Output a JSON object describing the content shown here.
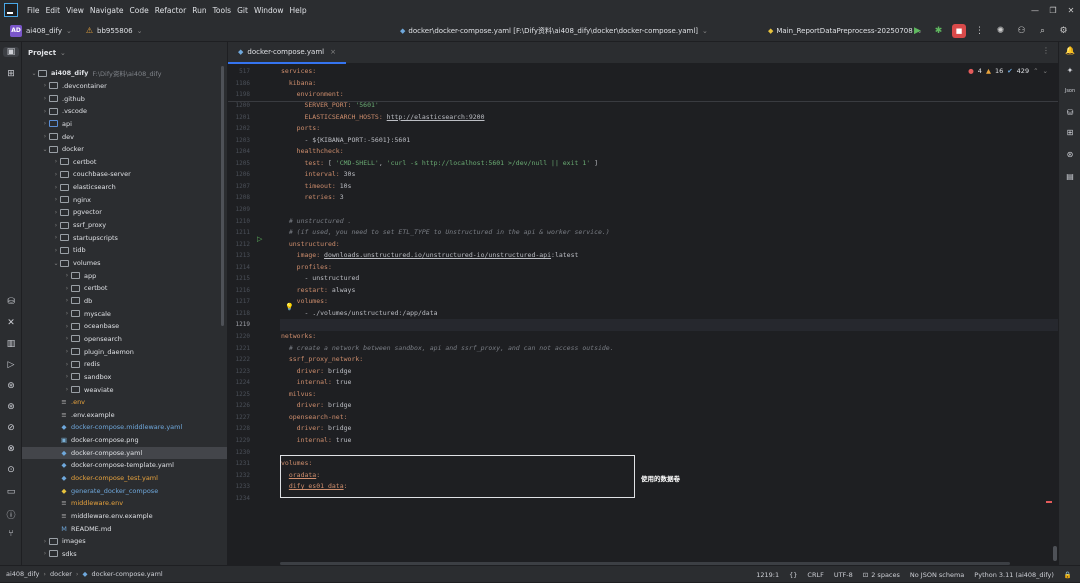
{
  "menu": [
    "File",
    "Edit",
    "View",
    "Navigate",
    "Code",
    "Refactor",
    "Run",
    "Tools",
    "Git",
    "Window",
    "Help"
  ],
  "window_controls": [
    "—",
    "❐",
    "✕"
  ],
  "toolbar": {
    "project_badge": "AD",
    "project_name": "ai408_dify",
    "branch": "bb955806",
    "file_path": "docker\\docker-compose.yaml [F:\\Dify资料\\ai408_dify\\docker\\docker-compose.yaml]",
    "run_config": "Main_ReportDataPreprocess-20250708"
  },
  "project_panel": {
    "title": "Project",
    "tree": [
      {
        "label": "ai408_dify",
        "extra": "F:\\Dify资料\\ai408_dify",
        "indent": 0,
        "type": "root",
        "open": true
      },
      {
        "label": ".devcontainer",
        "indent": 1,
        "type": "folder"
      },
      {
        "label": ".github",
        "indent": 1,
        "type": "folder"
      },
      {
        "label": ".vscode",
        "indent": 1,
        "type": "folder"
      },
      {
        "label": "api",
        "indent": 1,
        "type": "folder-blue"
      },
      {
        "label": "dev",
        "indent": 1,
        "type": "folder"
      },
      {
        "label": "docker",
        "indent": 1,
        "type": "folder",
        "open": true
      },
      {
        "label": "certbot",
        "indent": 2,
        "type": "folder"
      },
      {
        "label": "couchbase-server",
        "indent": 2,
        "type": "folder"
      },
      {
        "label": "elasticsearch",
        "indent": 2,
        "type": "folder"
      },
      {
        "label": "nginx",
        "indent": 2,
        "type": "folder"
      },
      {
        "label": "pgvector",
        "indent": 2,
        "type": "folder"
      },
      {
        "label": "ssrf_proxy",
        "indent": 2,
        "type": "folder"
      },
      {
        "label": "startupscripts",
        "indent": 2,
        "type": "folder"
      },
      {
        "label": "tidb",
        "indent": 2,
        "type": "folder"
      },
      {
        "label": "volumes",
        "indent": 2,
        "type": "folder",
        "open": true
      },
      {
        "label": "app",
        "indent": 3,
        "type": "folder"
      },
      {
        "label": "certbot",
        "indent": 3,
        "type": "folder"
      },
      {
        "label": "db",
        "indent": 3,
        "type": "folder"
      },
      {
        "label": "myscale",
        "indent": 3,
        "type": "folder"
      },
      {
        "label": "oceanbase",
        "indent": 3,
        "type": "folder"
      },
      {
        "label": "opensearch",
        "indent": 3,
        "type": "folder"
      },
      {
        "label": "plugin_daemon",
        "indent": 3,
        "type": "folder"
      },
      {
        "label": "redis",
        "indent": 3,
        "type": "folder"
      },
      {
        "label": "sandbox",
        "indent": 3,
        "type": "folder"
      },
      {
        "label": "weaviate",
        "indent": 3,
        "type": "folder"
      },
      {
        "label": ".env",
        "indent": 2,
        "type": "file-env",
        "color": "#e8a33d"
      },
      {
        "label": ".env.example",
        "indent": 2,
        "type": "file-env",
        "color": "#dfe1e5"
      },
      {
        "label": "docker-compose.middleware.yaml",
        "indent": 2,
        "type": "file-docker",
        "color": "#6fa8dc"
      },
      {
        "label": "docker-compose.png",
        "indent": 2,
        "type": "file-img",
        "color": "#dfe1e5"
      },
      {
        "label": "docker-compose.yaml",
        "indent": 2,
        "type": "file-docker",
        "color": "#dfe1e5",
        "selected": true
      },
      {
        "label": "docker-compose-template.yaml",
        "indent": 2,
        "type": "file-docker",
        "color": "#dfe1e5"
      },
      {
        "label": "docker-compose_test.yaml",
        "indent": 2,
        "type": "file-docker",
        "color": "#e8a33d"
      },
      {
        "label": "generate_docker_compose",
        "indent": 2,
        "type": "file-py",
        "color": "#6fa8dc"
      },
      {
        "label": "middleware.env",
        "indent": 2,
        "type": "file-env",
        "color": "#e8a33d"
      },
      {
        "label": "middleware.env.example",
        "indent": 2,
        "type": "file-env",
        "color": "#dfe1e5"
      },
      {
        "label": "README.md",
        "indent": 2,
        "type": "file-md",
        "color": "#dfe1e5"
      },
      {
        "label": "images",
        "indent": 1,
        "type": "folder"
      },
      {
        "label": "sdks",
        "indent": 1,
        "type": "folder"
      }
    ]
  },
  "editor": {
    "tab_label": "docker-compose.yaml",
    "inspections": {
      "errors": "4",
      "warnings": "16",
      "weak": "429"
    },
    "sticky": [
      {
        "ln": "517",
        "segs": [
          [
            "k",
            "services:"
          ]
        ],
        "ind": 0
      },
      {
        "ln": "1186",
        "segs": [
          [
            "k",
            "  kibana:"
          ]
        ],
        "ind": 1
      },
      {
        "ln": "1198",
        "segs": [
          [
            "k",
            "    environment:"
          ]
        ],
        "ind": 2
      }
    ],
    "lines": [
      {
        "ln": "1200",
        "segs": [
          [
            "k",
            "      SERVER_PORT: "
          ],
          [
            "s",
            "'5601'"
          ]
        ]
      },
      {
        "ln": "1201",
        "segs": [
          [
            "k",
            "      ELASTICSEARCH_HOSTS: "
          ],
          [
            "u",
            "http://elasticsearch:9200"
          ]
        ]
      },
      {
        "ln": "1202",
        "segs": [
          [
            "k",
            "    ports:"
          ]
        ]
      },
      {
        "ln": "1203",
        "segs": [
          [
            "v",
            "      - ${KIBANA_PORT:-5601}:5601"
          ]
        ]
      },
      {
        "ln": "1204",
        "segs": [
          [
            "k",
            "    healthcheck:"
          ]
        ]
      },
      {
        "ln": "1205",
        "segs": [
          [
            "k",
            "      test: "
          ],
          [
            "v",
            "[ "
          ],
          [
            "s",
            "'CMD-SHELL'"
          ],
          [
            "v",
            ", "
          ],
          [
            "s",
            "'curl -s http://localhost:5601 >/dev/null || exit 1'"
          ],
          [
            "v",
            " ]"
          ]
        ]
      },
      {
        "ln": "1206",
        "segs": [
          [
            "k",
            "      interval: "
          ],
          [
            "v",
            "30s"
          ]
        ]
      },
      {
        "ln": "1207",
        "segs": [
          [
            "k",
            "      timeout: "
          ],
          [
            "v",
            "10s"
          ]
        ]
      },
      {
        "ln": "1208",
        "segs": [
          [
            "k",
            "      retries: "
          ],
          [
            "v",
            "3"
          ]
        ]
      },
      {
        "ln": "1209",
        "segs": []
      },
      {
        "ln": "1210",
        "segs": [
          [
            "c",
            "  # unstructured ."
          ]
        ]
      },
      {
        "ln": "1211",
        "segs": [
          [
            "c",
            "  # (if used, you need to set ETL_TYPE to Unstructured in the api & worker service.)"
          ]
        ]
      },
      {
        "ln": "1212",
        "segs": [
          [
            "k",
            "  unstructured:"
          ]
        ]
      },
      {
        "ln": "1213",
        "segs": [
          [
            "k",
            "    image: "
          ],
          [
            "u",
            "downloads.unstructured.io/unstructured-io/unstructured-api"
          ],
          [
            "v",
            ":latest"
          ]
        ]
      },
      {
        "ln": "1214",
        "segs": [
          [
            "k",
            "    profiles:"
          ]
        ]
      },
      {
        "ln": "1215",
        "segs": [
          [
            "v",
            "      - unstructured"
          ]
        ]
      },
      {
        "ln": "1216",
        "segs": [
          [
            "k",
            "    restart: "
          ],
          [
            "v",
            "always"
          ]
        ]
      },
      {
        "ln": "1217",
        "segs": [
          [
            "k",
            "    volumes:"
          ]
        ]
      },
      {
        "ln": "1218",
        "segs": [
          [
            "v",
            "      - ./volumes/unstructured:/app/data"
          ]
        ]
      },
      {
        "ln": "1219",
        "segs": [],
        "current": true
      },
      {
        "ln": "1220",
        "segs": [
          [
            "k",
            "networks:"
          ]
        ]
      },
      {
        "ln": "1221",
        "segs": [
          [
            "c",
            "  # create a network between sandbox, api and ssrf_proxy, and can not access outside."
          ]
        ]
      },
      {
        "ln": "1222",
        "segs": [
          [
            "k",
            "  ssrf_proxy_network:"
          ]
        ]
      },
      {
        "ln": "1223",
        "segs": [
          [
            "k",
            "    driver: "
          ],
          [
            "v",
            "bridge"
          ]
        ]
      },
      {
        "ln": "1224",
        "segs": [
          [
            "k",
            "    internal: "
          ],
          [
            "v",
            "true"
          ]
        ]
      },
      {
        "ln": "1225",
        "segs": [
          [
            "k",
            "  milvus:"
          ]
        ]
      },
      {
        "ln": "1226",
        "segs": [
          [
            "k",
            "    driver: "
          ],
          [
            "v",
            "bridge"
          ]
        ]
      },
      {
        "ln": "1227",
        "segs": [
          [
            "k",
            "  opensearch-net:"
          ]
        ]
      },
      {
        "ln": "1228",
        "segs": [
          [
            "k",
            "    driver: "
          ],
          [
            "v",
            "bridge"
          ]
        ]
      },
      {
        "ln": "1229",
        "segs": [
          [
            "k",
            "    internal: "
          ],
          [
            "v",
            "true"
          ]
        ]
      },
      {
        "ln": "1230",
        "segs": []
      },
      {
        "ln": "1231",
        "segs": [
          [
            "k",
            "volumes:"
          ]
        ]
      },
      {
        "ln": "1232",
        "segs": [
          [
            "k",
            "  "
          ],
          [
            "ku",
            "oradata"
          ],
          [
            "k",
            ":"
          ]
        ]
      },
      {
        "ln": "1233",
        "segs": [
          [
            "k",
            "  "
          ],
          [
            "ku",
            "dify_es01_data"
          ],
          [
            "k",
            ":"
          ]
        ]
      },
      {
        "ln": "1234",
        "segs": []
      }
    ],
    "annotation": "使用的数据卷"
  },
  "statusbar": {
    "crumbs": [
      "ai408_dify",
      "docker",
      "docker-compose.yaml"
    ],
    "position": "1219:1",
    "line_sep": "CRLF",
    "encoding": "UTF-8",
    "indent": "2 spaces",
    "schema": "No JSON schema",
    "interpreter": "Python 3.11 (ai408_dify)"
  }
}
